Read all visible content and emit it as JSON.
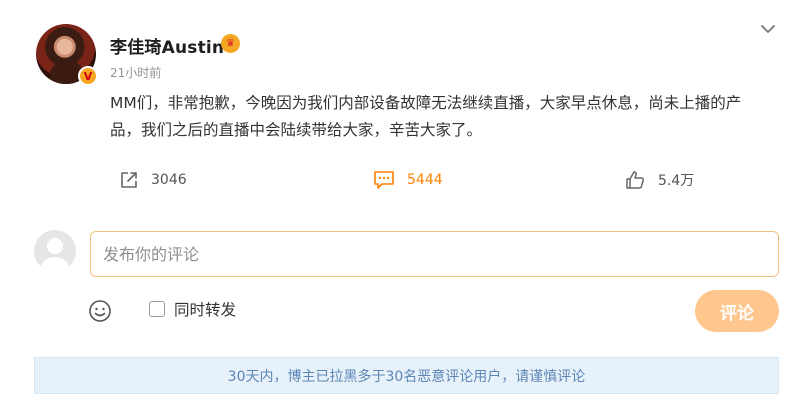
{
  "author": {
    "name": "李佳琦Austin",
    "time": "21小时前",
    "avatar_icon": "author-avatar",
    "verified_icon": "verified-badge",
    "vip_icon": "vip-crown-icon"
  },
  "post": {
    "text": "MM们，非常抱歉，今晚因为我们内部设备故障无法继续直播，大家早点休息，尚未上播的产品，我们之后的直播中会陆续带给大家，辛苦大家了。"
  },
  "actions": {
    "share_count": "3046",
    "comment_count": "5444",
    "like_count": "5.4万",
    "comment_color": "#ff8200"
  },
  "comment_box": {
    "placeholder": "发布你的评论",
    "repost_label": "同时转发",
    "submit_label": "评论",
    "submit_color": "#ffc68e",
    "border_color": "#f0c27d"
  },
  "notice": {
    "text": "30天内，博主已拉黑多于30名恶意评论用户，请谨慎评论",
    "background": "#e6f1fa",
    "color": "#5d86b5"
  }
}
